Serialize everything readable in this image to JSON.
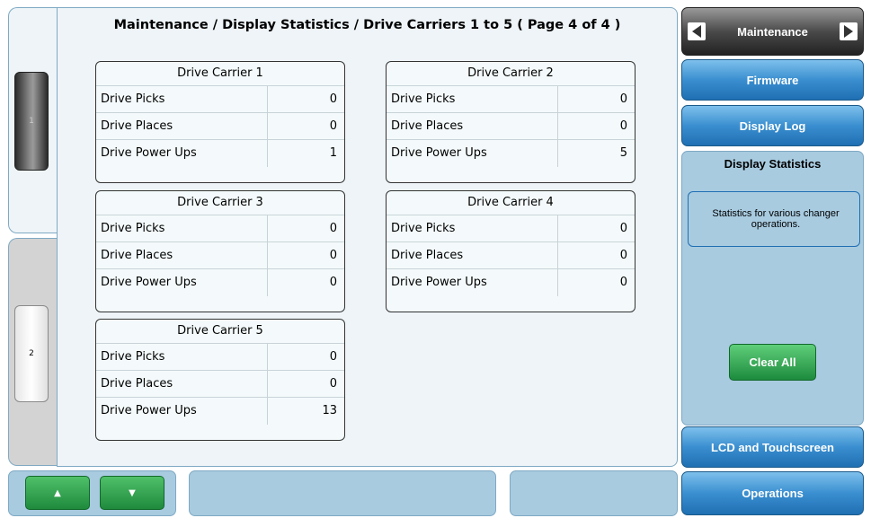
{
  "page_title": "Maintenance / Display Statistics / Drive Carriers 1 to 5 ( Page 4 of 4 )",
  "left_rail": {
    "slot_1_label": "1",
    "slot_2_label": "2"
  },
  "carriers": [
    {
      "title": "Drive Carrier 1",
      "rows": [
        {
          "label": "Drive Picks",
          "value": "0"
        },
        {
          "label": "Drive Places",
          "value": "0"
        },
        {
          "label": "Drive Power Ups",
          "value": "1"
        }
      ]
    },
    {
      "title": "Drive Carrier 2",
      "rows": [
        {
          "label": "Drive Picks",
          "value": "0"
        },
        {
          "label": "Drive Places",
          "value": "0"
        },
        {
          "label": "Drive Power Ups",
          "value": "5"
        }
      ]
    },
    {
      "title": "Drive Carrier 3",
      "rows": [
        {
          "label": "Drive Picks",
          "value": "0"
        },
        {
          "label": "Drive Places",
          "value": "0"
        },
        {
          "label": "Drive Power Ups",
          "value": "0"
        }
      ]
    },
    {
      "title": "Drive Carrier 4",
      "rows": [
        {
          "label": "Drive Picks",
          "value": "0"
        },
        {
          "label": "Drive Places",
          "value": "0"
        },
        {
          "label": "Drive Power Ups",
          "value": "0"
        }
      ]
    },
    {
      "title": "Drive Carrier 5",
      "rows": [
        {
          "label": "Drive Picks",
          "value": "0"
        },
        {
          "label": "Drive Places",
          "value": "0"
        },
        {
          "label": "Drive Power Ups",
          "value": "13"
        }
      ]
    }
  ],
  "bottom_bar": {
    "up_icon": "triangle-up",
    "down_icon": "triangle-down"
  },
  "nav": {
    "header_label": "Maintenance",
    "firmware_label": "Firmware",
    "display_log_label": "Display Log",
    "active_label": "Display Statistics",
    "active_description": "Statistics for various changer operations.",
    "clear_all_label": "Clear All",
    "lcd_label": "LCD and Touchscreen",
    "operations_label": "Operations"
  },
  "colors": {
    "accent_blue": "#1f6fb3",
    "action_green": "#1d8b3d",
    "panel_background": "#eef4f7",
    "active_panel": "#a8cbe0"
  }
}
